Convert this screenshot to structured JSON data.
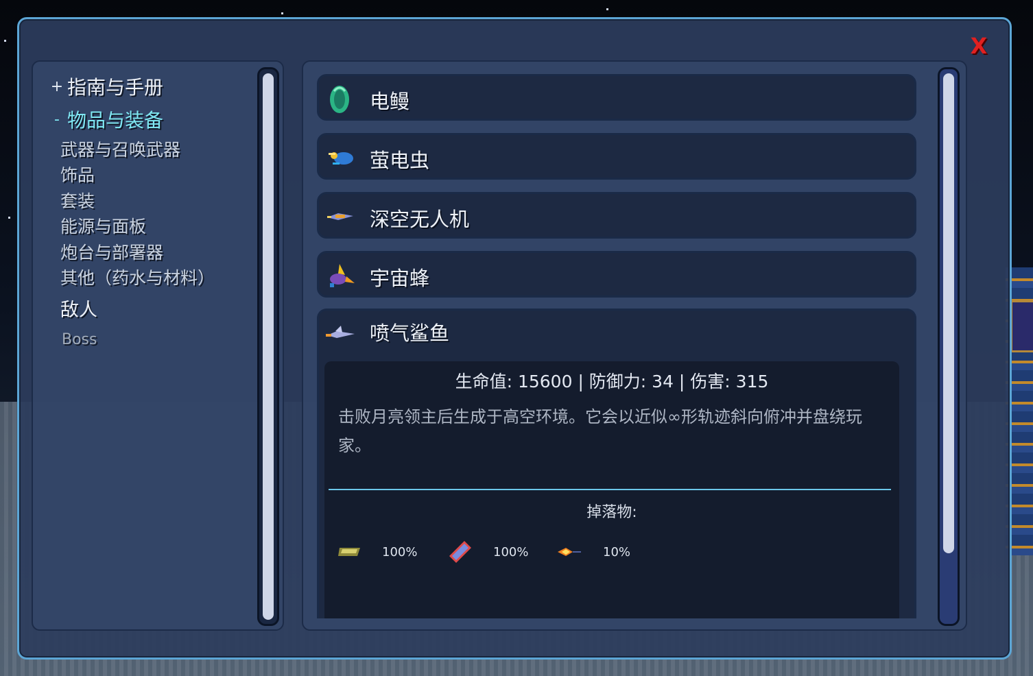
{
  "window": {
    "close_label": "X"
  },
  "nav": {
    "guide": {
      "marker": "+",
      "label": "指南与手册"
    },
    "items_equipment": {
      "marker": "-",
      "label": "物品与装备"
    },
    "sub_items": [
      "武器与召唤武器",
      "饰品",
      "套装",
      "能源与面板",
      "炮台与部署器",
      "其他（药水与材料）"
    ],
    "enemies": "敌人",
    "boss": "Boss"
  },
  "entries": [
    {
      "name": "电鳗",
      "icon": "eel-icon"
    },
    {
      "name": "萤电虫",
      "icon": "firefly-icon"
    },
    {
      "name": "深空无人机",
      "icon": "drone-icon"
    },
    {
      "name": "宇宙蜂",
      "icon": "bee-icon"
    }
  ],
  "expanded_entry": {
    "name": "喷气鲨鱼",
    "icon": "jet-shark-icon",
    "stats": "生命值: 15600 | 防御力: 34 | 伤害: 315",
    "description": "击败月亮领主后生成于高空环境。它会以近似∞形轨迹斜向俯冲并盘绕玩家。",
    "drops_label": "掉落物:",
    "drops": [
      {
        "icon": "bar-icon",
        "chance": "100%"
      },
      {
        "icon": "crystal-icon",
        "chance": "100%"
      },
      {
        "icon": "flame-rocket-icon",
        "chance": "10%"
      }
    ]
  },
  "colors": {
    "accent": "#7fe7f2",
    "close": "#e02020",
    "border": "#5ca6d6"
  }
}
